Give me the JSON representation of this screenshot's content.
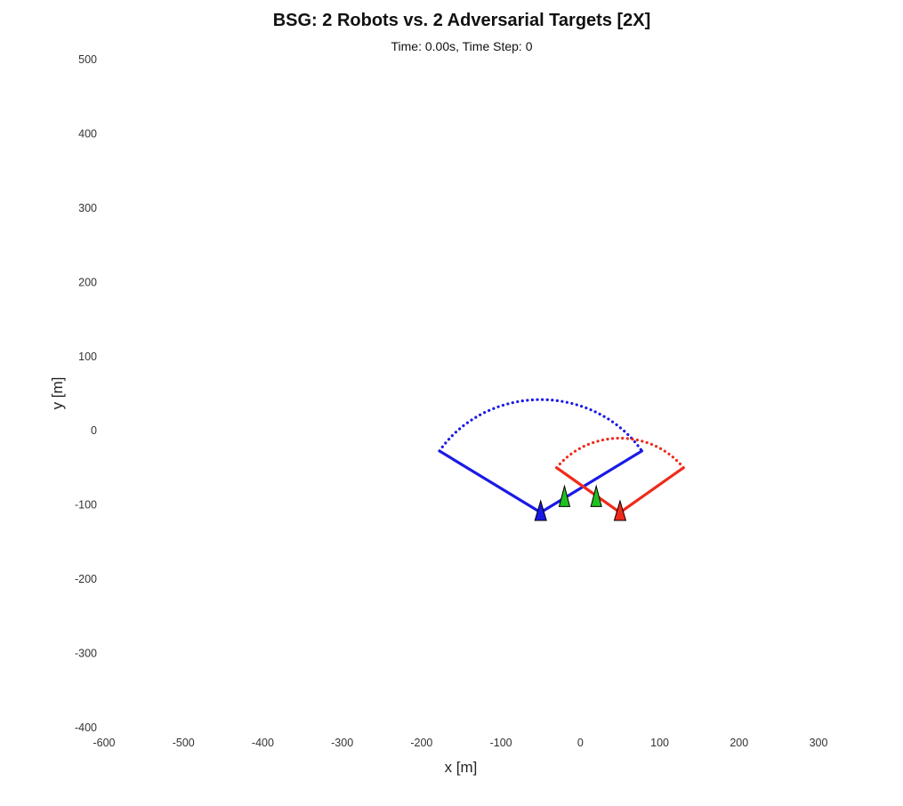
{
  "chart_data": {
    "type": "scatter",
    "title": "BSG: 2 Robots vs. 2 Adversarial Targets [2X]",
    "subtitle": "Time: 0.00s, Time Step: 0",
    "xlabel": "x [m]",
    "ylabel": "y [m]",
    "xlim": [
      -600,
      300
    ],
    "ylim": [
      -400,
      500
    ],
    "xticks": [
      -600,
      -500,
      -400,
      -300,
      -200,
      -100,
      0,
      100,
      200,
      300
    ],
    "yticks": [
      -400,
      -300,
      -200,
      -100,
      0,
      100,
      200,
      300,
      400,
      500
    ],
    "grid": false,
    "robots": [
      {
        "color": "#1a1ae6",
        "position": [
          -50,
          -110
        ],
        "heading_deg": 90,
        "fov_half_angle_deg": 57,
        "fov_range": 152
      },
      {
        "color": "#f02a1a",
        "position": [
          50,
          -110
        ],
        "heading_deg": 90,
        "fov_half_angle_deg": 53,
        "fov_range": 100
      }
    ],
    "targets": [
      {
        "color": "#20c020",
        "position": [
          -20,
          -90
        ]
      },
      {
        "color": "#20c020",
        "position": [
          20,
          -90
        ]
      }
    ]
  }
}
